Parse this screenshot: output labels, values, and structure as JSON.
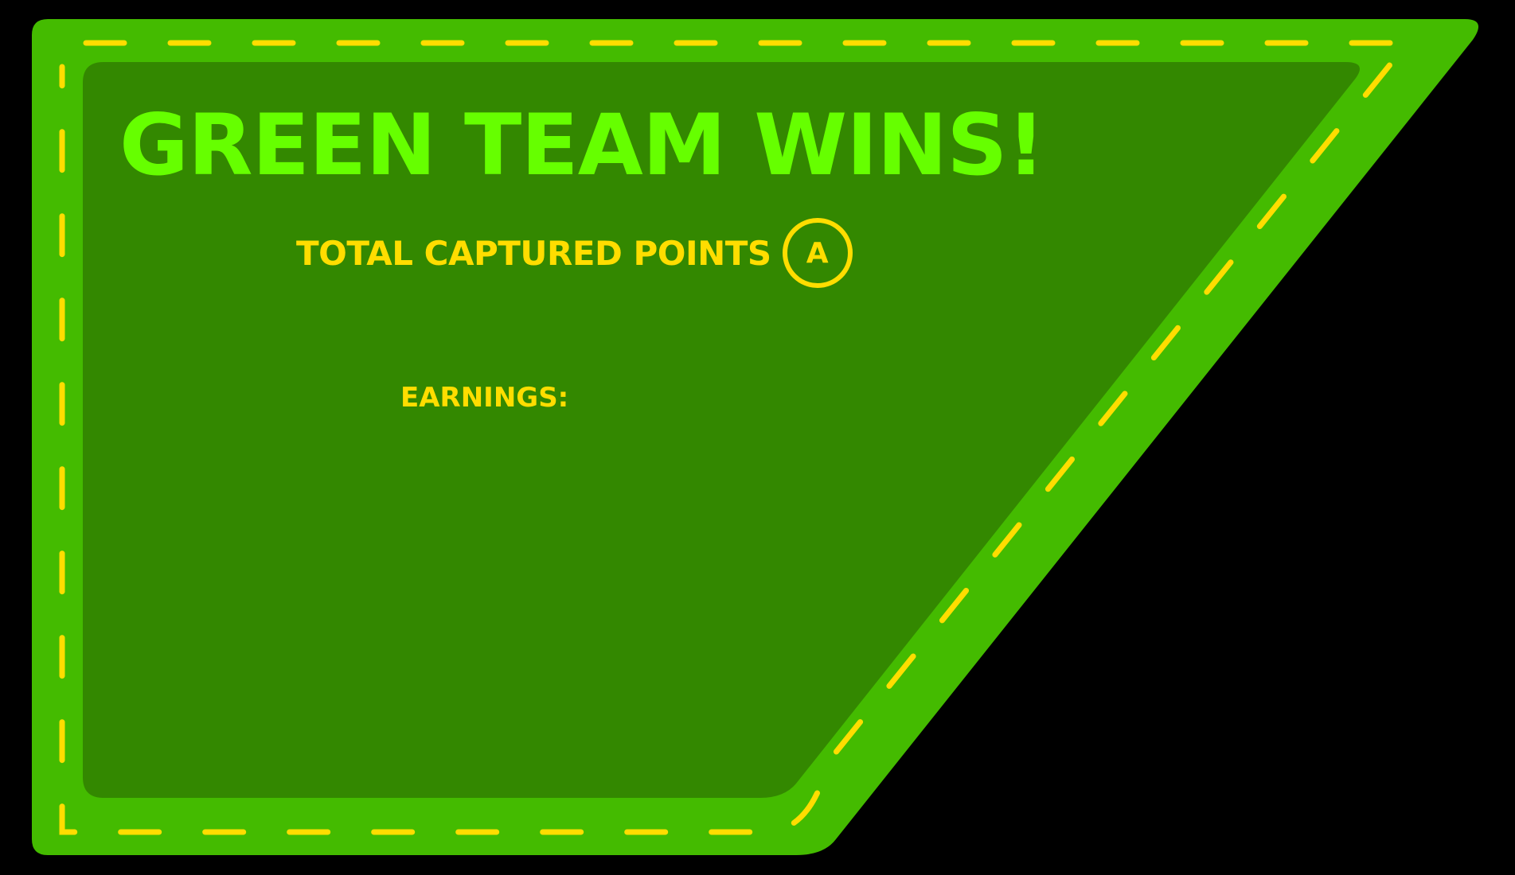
{
  "result": {
    "title": "GREEN TEAM WINS!",
    "captured_label": "TOTAL CAPTURED POINTS",
    "captured_points": [
      "A"
    ],
    "earnings_label": "EARNINGS:"
  },
  "colors": {
    "background": "#000000",
    "panel_outer": "#44bb00",
    "panel_inner": "#338800",
    "stitch": "#ffdd00",
    "title": "#66ff00",
    "text": "#ffdd00"
  }
}
